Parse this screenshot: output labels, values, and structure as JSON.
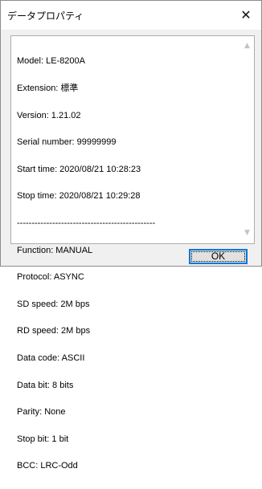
{
  "window": {
    "title": "データプロパティ",
    "close_glyph": "✕"
  },
  "properties": {
    "lines": [
      "Model: LE-8200A",
      "Extension: 標準",
      "Version: 1.21.02",
      "Serial number: 99999999",
      "Start time: 2020/08/21 10:28:23",
      "Stop time: 2020/08/21 10:29:28",
      "-----------------------------------------------",
      "Function: MANUAL",
      "Protocol: ASYNC",
      "SD speed: 2M bps",
      "RD speed: 2M bps",
      "Data code: ASCII",
      "Data bit: 8 bits",
      "Parity: None",
      "Stop bit: 1 bit",
      "BCC: LRC-Odd"
    ]
  },
  "scrollbar": {
    "up_glyph": "▲",
    "down_glyph": "▼"
  },
  "buttons": {
    "ok_label": "OK"
  },
  "colors": {
    "focus_border": "#0078d7",
    "dialog_bg": "#f0f0f0"
  }
}
